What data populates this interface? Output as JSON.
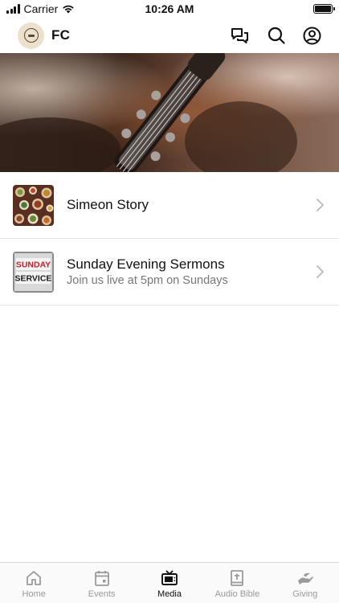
{
  "status_bar": {
    "carrier": "Carrier",
    "time": "10:26 AM"
  },
  "header": {
    "brand": "FC"
  },
  "hero": {
    "image": "guitar-headstock"
  },
  "items": [
    {
      "title": "Simeon Story",
      "subtitle": ""
    },
    {
      "title": "Sunday Evening Sermons",
      "subtitle": "Join us live at 5pm on Sundays"
    }
  ],
  "thumb_text": {
    "line1": "SUNDAY",
    "line2": "SERVICE"
  },
  "tabs": [
    {
      "label": "Home",
      "icon": "home-icon",
      "active": false
    },
    {
      "label": "Events",
      "icon": "calendar-icon",
      "active": false
    },
    {
      "label": "Media",
      "icon": "tv-icon",
      "active": true
    },
    {
      "label": "Audio Bible",
      "icon": "bible-icon",
      "active": false
    },
    {
      "label": "Giving",
      "icon": "hand-icon",
      "active": false
    }
  ],
  "colors": {
    "active": "#111111",
    "inactive": "#9a9a9a",
    "accent_red": "#c8202a"
  }
}
